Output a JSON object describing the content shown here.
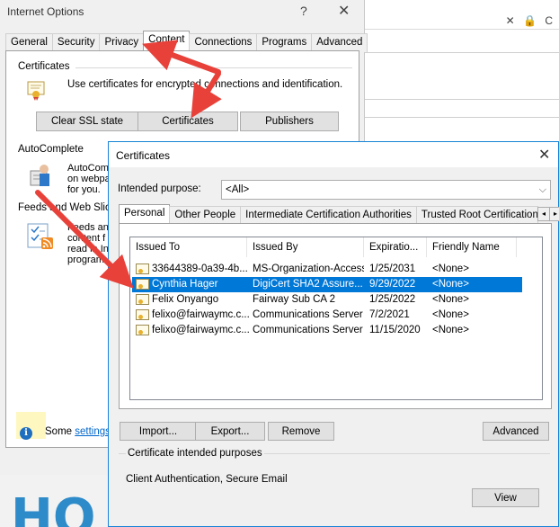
{
  "internet_options": {
    "title": "Internet Options",
    "help_label": "?",
    "close_label": "✕",
    "tabs": [
      "General",
      "Security",
      "Privacy",
      "Content",
      "Connections",
      "Programs",
      "Advanced"
    ],
    "active_tab": "Content",
    "certificates_group": "Certificates",
    "certificates_desc": "Use certificates for encrypted connections and identification.",
    "buttons": {
      "clear_ssl": "Clear SSL state",
      "certificates": "Certificates",
      "publishers": "Publishers"
    },
    "autocomplete_group": "AutoComplete",
    "autocomplete_text": [
      "AutoCom",
      "on webpa",
      "for you."
    ],
    "feeds_group": "Feeds and Web Slices",
    "feeds_text": [
      "Feeds an",
      "content f",
      "read in In",
      "program"
    ],
    "footer_prefix": "Some",
    "footer_link": "settings"
  },
  "certificates_dialog": {
    "title": "Certificates",
    "close_label": "✕",
    "intended_purpose_label": "Intended purpose:",
    "intended_purpose_value": "<All>",
    "tabs": [
      "Personal",
      "Other People",
      "Intermediate Certification Authorities",
      "Trusted Root Certification"
    ],
    "active_tab": "Personal",
    "columns": [
      "Issued To",
      "Issued By",
      "Expiratio...",
      "Friendly Name"
    ],
    "rows": [
      {
        "issued_to": "33644389-0a39-4b...",
        "issued_by": "MS-Organization-Access",
        "expiration": "1/25/2031",
        "friendly_name": "<None>"
      },
      {
        "issued_to": "Cynthia Hager",
        "issued_by": "DigiCert SHA2 Assure...",
        "expiration": "9/29/2022",
        "friendly_name": "<None>"
      },
      {
        "issued_to": "Felix Onyango",
        "issued_by": "Fairway Sub CA 2",
        "expiration": "1/25/2022",
        "friendly_name": "<None>"
      },
      {
        "issued_to": "felixo@fairwaymc.c...",
        "issued_by": "Communications Server",
        "expiration": "7/2/2021",
        "friendly_name": "<None>"
      },
      {
        "issued_to": "felixo@fairwaymc.c...",
        "issued_by": "Communications Server",
        "expiration": "11/15/2020",
        "friendly_name": "<None>"
      }
    ],
    "selected_row_index": 1,
    "buttons": {
      "import": "Import...",
      "export": "Export...",
      "remove": "Remove",
      "advanced": "Advanced",
      "view": "View"
    },
    "purposes_group": "Certificate intended purposes",
    "purposes_value": "Client Authentication, Secure Email"
  },
  "browser": {
    "address_icons": "✕ 🔒 C",
    "logo_text": "HO"
  },
  "colors": {
    "selection": "#0078d7",
    "arrow": "#e8413a",
    "link": "#0066cc",
    "dialog_border": "#1883d7"
  }
}
